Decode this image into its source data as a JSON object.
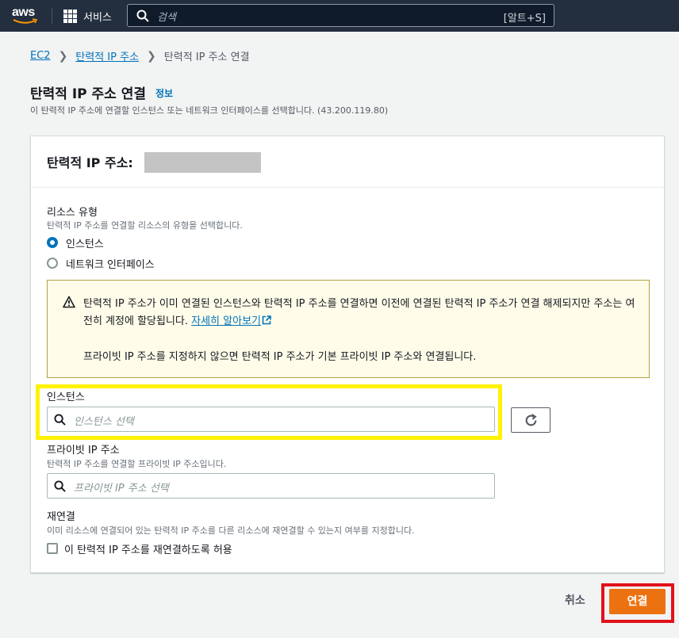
{
  "nav": {
    "logo_text": "aws",
    "services_label": "서비스",
    "search_placeholder": "검색",
    "search_shortcut": "[알트+S]"
  },
  "breadcrumb": {
    "items": [
      "EC2",
      "탄력적 IP 주소"
    ],
    "current": "탄력적 IP 주소 연결"
  },
  "header": {
    "title": "탄력적 IP 주소 연결",
    "info_link": "정보",
    "description": "이 탄력적 IP 주소에 연결할 인스턴스 또는 네트워크 인터페이스를 선택합니다. (43.200.119.80)"
  },
  "card": {
    "title": "탄력적 IP 주소:",
    "resource_type": {
      "label": "리소스 유형",
      "description": "탄력적 IP 주소를 연결할 리소스의 유형을 선택합니다.",
      "options": [
        "인스턴스",
        "네트워크 인터페이스"
      ],
      "selected": "인스턴스"
    },
    "alert": {
      "line1": "탄력적 IP 주소가 이미 연결된 인스턴스와 탄력적 IP 주소를 연결하면 이전에 연결된 탄력적 IP 주소가 연결 해제되지만 주소는 여전히 계정에 할당됩니다.",
      "learn_more": "자세히 알아보기",
      "line2": "프라이빗 IP 주소를 지정하지 않으면 탄력적 IP 주소가 기본 프라이빗 IP 주소와 연결됩니다."
    },
    "instance": {
      "label": "인스턴스",
      "placeholder": "인스턴스 선택"
    },
    "private_ip": {
      "label": "프라이빗 IP 주소",
      "description": "탄력적 IP 주소를 연결할 프라이빗 IP 주소입니다.",
      "placeholder": "프라이빗 IP 주소 선택"
    },
    "reassociation": {
      "label": "재연결",
      "description": "이미 리소스에 연결되어 있는 탄력적 IP 주소를 다른 리소스에 재연결할 수 있는지 여부를 지정합니다.",
      "checkbox_label": "이 탄력적 IP 주소를 재연결하도록 허용",
      "checked": false
    }
  },
  "actions": {
    "cancel": "취소",
    "connect": "연결"
  },
  "colors": {
    "nav_bg": "#232f3e",
    "link": "#0073bb",
    "primary_button": "#ec7211",
    "alert_bg": "#fffce9",
    "highlight_yellow": "#fff200",
    "highlight_red": "#e1121b"
  }
}
